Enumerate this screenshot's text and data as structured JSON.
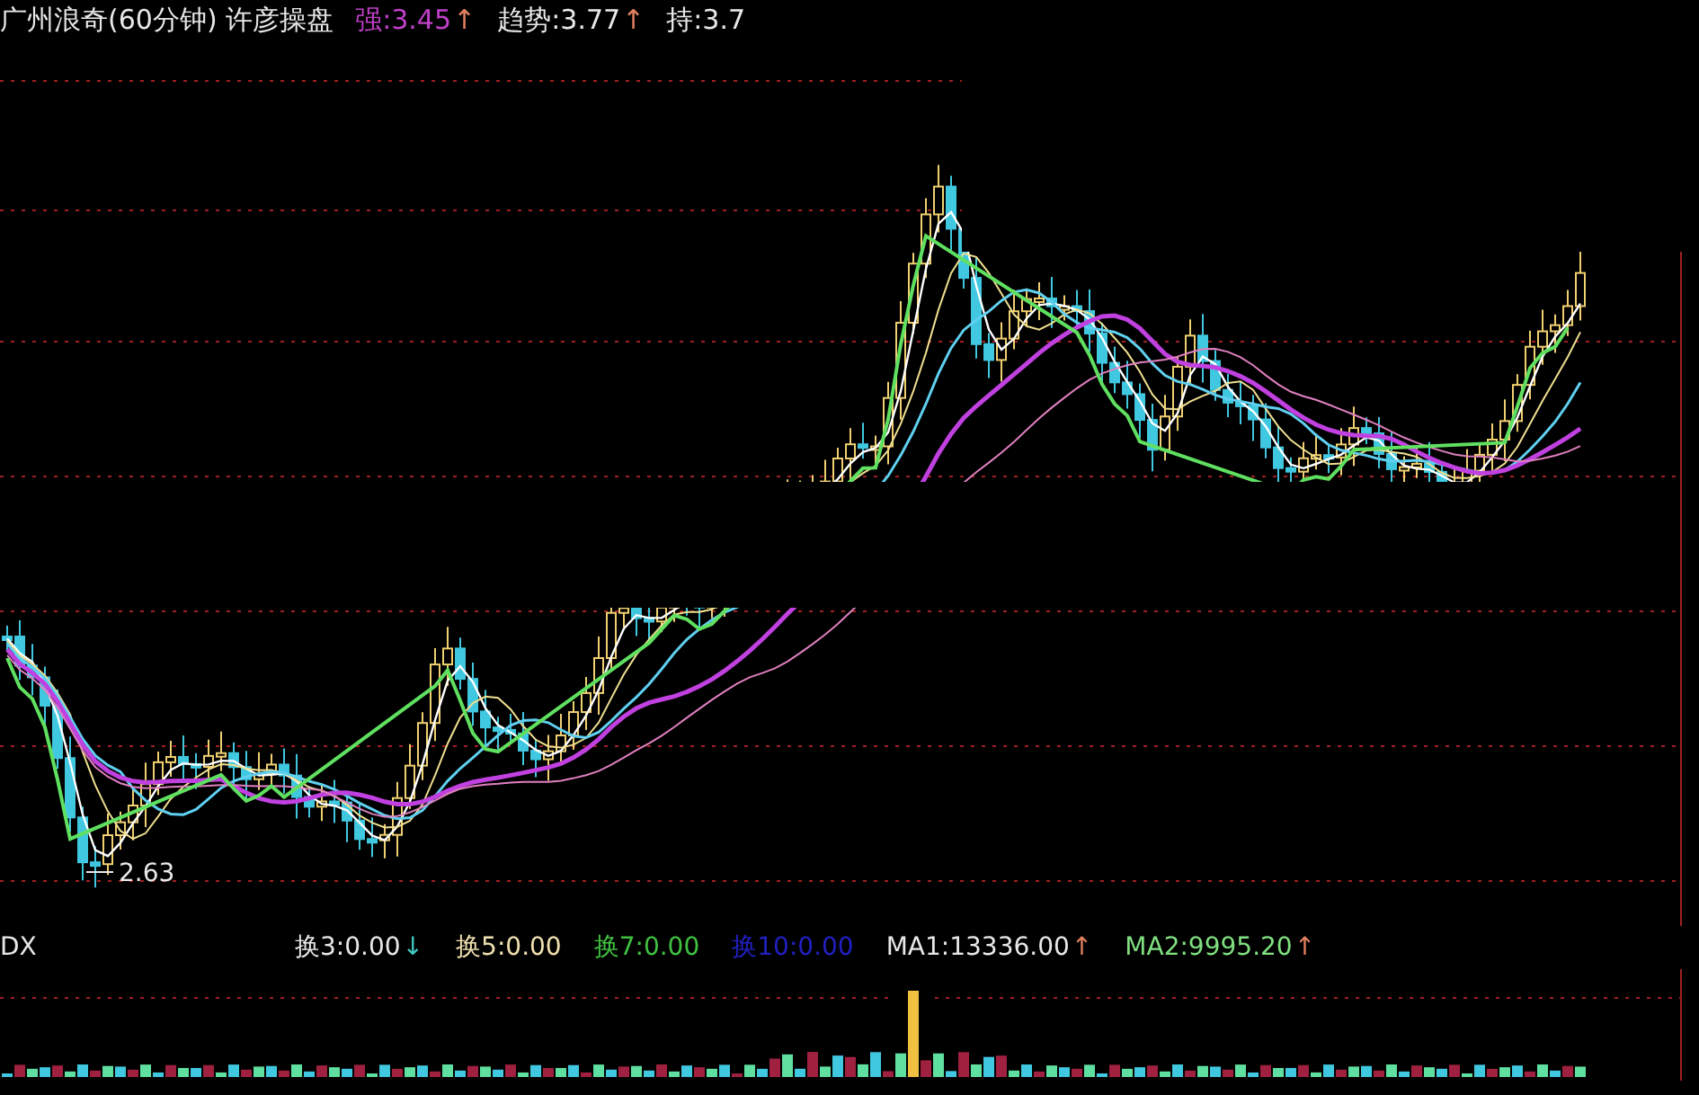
{
  "header": {
    "title": "广州浪奇(60分钟) 许彦操盘",
    "indicators": [
      {
        "text": "强:3.45",
        "arrow": {
          "text": "↑",
          "color": "#e08060"
        },
        "color": "#c040c8"
      },
      {
        "text": "趋势:3.77",
        "arrow": {
          "text": "↑",
          "color": "#e08060"
        },
        "color": "#e8e8e8"
      },
      {
        "text": "持:3.7",
        "color": "#e8e8e8"
      }
    ]
  },
  "main_chart": {
    "low_marker": "2.63"
  },
  "volume_panel": {
    "name": "DX",
    "indicators": [
      {
        "text": "换3:0.00",
        "arrow": {
          "text": "↓",
          "color": "#40c8c0"
        },
        "color": "#e8e8e8"
      },
      {
        "text": "换5:0.00",
        "color": "#f0e0b0"
      },
      {
        "text": "换7:0.00",
        "color": "#40c040"
      },
      {
        "text": "换10:0.00",
        "color": "#2020c0"
      },
      {
        "text": "MA1:13336.00",
        "arrow": {
          "text": "↑",
          "color": "#e08060"
        },
        "color": "#e8e8e8"
      },
      {
        "text": "MA2:9995.20",
        "arrow": {
          "text": "↑",
          "color": "#e08060"
        },
        "color": "#80e080"
      }
    ]
  }
}
